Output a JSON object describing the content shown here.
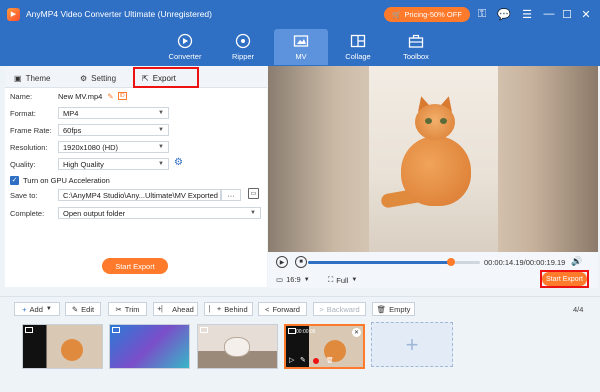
{
  "window": {
    "title": "AnyMP4 Video Converter Ultimate (Unregistered)",
    "promo_label": "Pricing-50% OFF"
  },
  "nav": {
    "items": [
      {
        "label": "Converter",
        "icon": "converter-icon"
      },
      {
        "label": "Ripper",
        "icon": "ripper-icon"
      },
      {
        "label": "MV",
        "icon": "mv-icon",
        "active": true
      },
      {
        "label": "Collage",
        "icon": "collage-icon"
      },
      {
        "label": "Toolbox",
        "icon": "toolbox-icon"
      }
    ]
  },
  "left_tabs": {
    "theme": "Theme",
    "setting": "Setting",
    "export": "Export"
  },
  "export_form": {
    "name_label": "Name:",
    "name_value": "New MV.mp4",
    "format_label": "Format:",
    "format_value": "MP4",
    "frame_rate_label": "Frame Rate:",
    "frame_rate_value": "60fps",
    "resolution_label": "Resolution:",
    "resolution_value": "1920x1080 (HD)",
    "quality_label": "Quality:",
    "quality_value": "High Quality",
    "gpu_label": "Turn on GPU Acceleration",
    "gpu_checked": true,
    "save_to_label": "Save to:",
    "save_to_value": "C:\\AnyMP4 Studio\\Any...Ultimate\\MV Exported",
    "save_to_more": "···",
    "complete_label": "Complete:",
    "complete_value": "Open output folder",
    "start_export_label": "Start Export"
  },
  "player": {
    "timecode": "00:00:14.19/00:00:19.19",
    "progress_fraction": 0.83,
    "aspect_ratio": "16:9",
    "fit": "Full",
    "start_export_label": "Start Export"
  },
  "toolbar": {
    "add": "Add",
    "edit": "Edit",
    "trim": "Trim",
    "ahead": "Ahead",
    "behind": "Behind",
    "forward": "Forward",
    "backward": "Backward",
    "empty": "Empty",
    "count": "4/4"
  },
  "timeline": {
    "selected_clip_time": "00:00:05"
  },
  "colors": {
    "brand_blue": "#2f6fc4",
    "accent_orange": "#ff7a2b",
    "highlight_red": "#e11111"
  }
}
